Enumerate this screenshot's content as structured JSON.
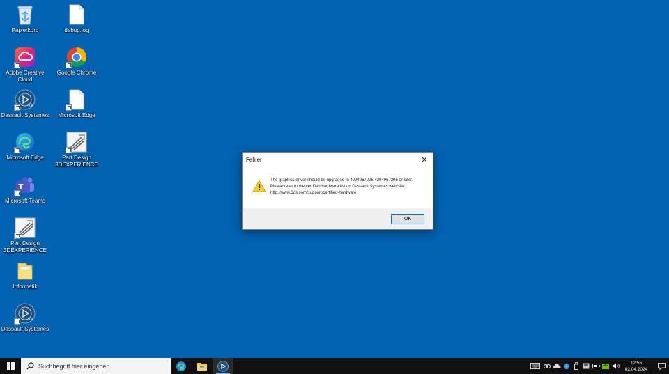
{
  "desktop": {
    "icons": [
      {
        "label": "Papierkorb",
        "icon": "recycle-bin-icon"
      },
      {
        "label": "debug.log",
        "icon": "file-icon"
      },
      {
        "label": "Adobe Creative Cloud",
        "icon": "adobe-creative-cloud-icon"
      },
      {
        "label": "Google Chrome",
        "icon": "chrome-icon"
      },
      {
        "label": "Dassault Systemes",
        "icon": "dassault-3dexperience-icon"
      },
      {
        "label": "Microsoft Edge",
        "icon": "file-icon"
      },
      {
        "label": "Microsoft Edge",
        "icon": "edge-icon"
      },
      {
        "label": "Part Design 3DEXPERIENCE R...",
        "icon": "part-design-icon"
      },
      {
        "label": "Microsoft Teams",
        "icon": "teams-icon"
      },
      {
        "label": "Part Design 3DEXPERIENCE R...",
        "icon": "part-design-icon"
      },
      {
        "label": "Informatik",
        "icon": "folder-icon"
      },
      {
        "label": "Dassault Systemes",
        "icon": "dassault-3dexperience-icon"
      }
    ]
  },
  "dialog": {
    "title": "Fehler",
    "close_glyph": "✕",
    "message": "The graphics driver should be upgraded to 4294967295.4294967295 or later. Please refer to the certified hardware list on Dassault Systemes web site : http://www.3ds.com/support/certified-hardware.",
    "ok_label": "OK",
    "icon": "warning-icon"
  },
  "taskbar": {
    "search_placeholder": "Suchbegriff hier eingeben",
    "apps": [
      "edge-icon",
      "file-explorer-icon",
      "dassault-3dexperience-icon"
    ],
    "time": "12:55",
    "date": "02.04.2024"
  },
  "colors": {
    "desktop_bg": "#0063b1",
    "taskbar_bg": "#101010",
    "accent": "#0078d7"
  }
}
